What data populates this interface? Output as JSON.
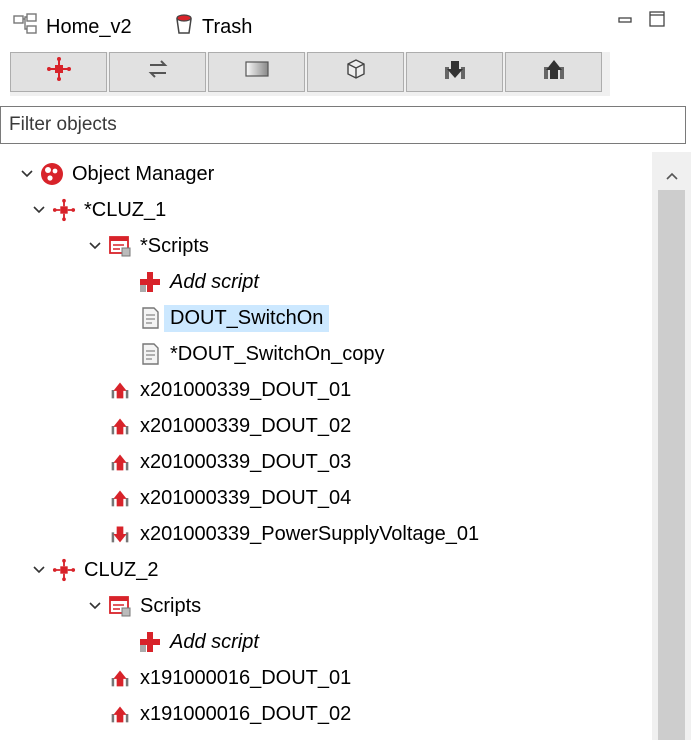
{
  "tabs": {
    "home": {
      "label": "Home_v2",
      "icon": "home-project-icon"
    },
    "trash": {
      "label": "Trash",
      "icon": "trash-icon"
    }
  },
  "window_controls": [
    "minimize-icon",
    "maximize-icon"
  ],
  "toolbar": {
    "buttons": [
      {
        "name": "cluz-device-button",
        "icon": "cluz-device-icon"
      },
      {
        "name": "swap-button",
        "icon": "swap-arrows-icon"
      },
      {
        "name": "panel-button",
        "icon": "panel-icon"
      },
      {
        "name": "object-box-button",
        "icon": "box-icon"
      },
      {
        "name": "import-button",
        "icon": "download-icon"
      },
      {
        "name": "export-button",
        "icon": "upload-icon"
      }
    ]
  },
  "filter": {
    "placeholder": "Filter objects",
    "value": ""
  },
  "tree": {
    "root": {
      "label": "Object Manager"
    },
    "cluz1": {
      "label": "*CLUZ_1",
      "scripts_label": "*Scripts",
      "add_script": "Add script",
      "script1": "DOUT_SwitchOn",
      "script2": "*DOUT_SwitchOn_copy",
      "outputs": [
        "x201000339_DOUT_01",
        "x201000339_DOUT_02",
        "x201000339_DOUT_03",
        "x201000339_DOUT_04"
      ],
      "input": "x201000339_PowerSupplyVoltage_01"
    },
    "cluz2": {
      "label": "CLUZ_2",
      "scripts_label": "Scripts",
      "add_script": "Add script",
      "outputs": [
        "x191000016_DOUT_01",
        "x191000016_DOUT_02"
      ]
    }
  },
  "colors": {
    "accent": "#d8232a",
    "selection": "#cce8ff"
  }
}
